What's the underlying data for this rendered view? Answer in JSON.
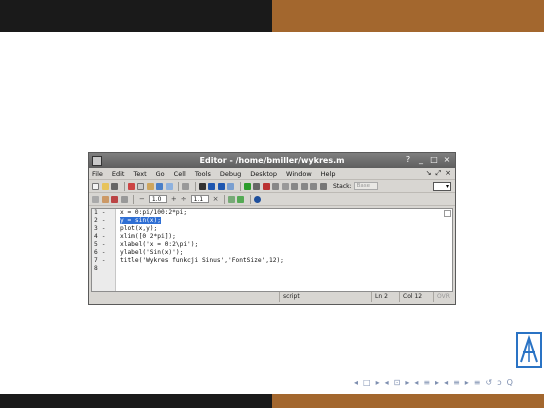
{
  "window": {
    "title": "Editor - /home/bmiller/wykres.m",
    "buttons": [
      "?",
      "_",
      "□",
      "×"
    ]
  },
  "menu": {
    "items": [
      "File",
      "Edit",
      "Text",
      "Go",
      "Cell",
      "Tools",
      "Debug",
      "Desktop",
      "Window",
      "Help"
    ],
    "right_icons": [
      "↘",
      "⤢",
      "×"
    ]
  },
  "toolbar": {
    "stack_label": "Stack:",
    "stack_value": "Base",
    "layout_value": "▾"
  },
  "cellbar": {
    "minus1": "−",
    "value1": "1.0",
    "plus1": "+",
    "div": "÷",
    "value2": "1.1",
    "mult": "×"
  },
  "editor": {
    "line_numbers": [
      "1",
      "2",
      "3",
      "4",
      "5",
      "6",
      "7",
      "8"
    ],
    "dashes": [
      "-",
      "-",
      "-",
      "-",
      "-",
      "-",
      "-",
      ""
    ],
    "lines": [
      "x = 0:pi/100:2*pi;",
      "y = sin(x);",
      "plot(x,y);",
      "xlim([0 2*pi]);",
      "xlabel('x = 0:2\\pi');",
      "ylabel('Sin(x)');",
      "title('Wykres funkcji Sinus','FontSize',12);",
      ""
    ]
  },
  "status": {
    "type": "script",
    "ln_label": "Ln",
    "ln_value": "2",
    "col_label": "Col",
    "col_value": "12",
    "ovr": "OVR"
  },
  "nav": {
    "symbols": [
      "◂",
      "□",
      "▸",
      "◂",
      "⊡",
      "▸",
      "◂",
      "≡",
      "▸",
      "◂",
      "≡",
      "▸",
      "≡",
      "↺",
      "ↄ",
      "Q"
    ]
  },
  "colors": {
    "top_bar_dark": "#1a1a1a",
    "top_bar_brown": "#a3672e",
    "selection": "#2f6fd4",
    "string": "#a020f0"
  }
}
